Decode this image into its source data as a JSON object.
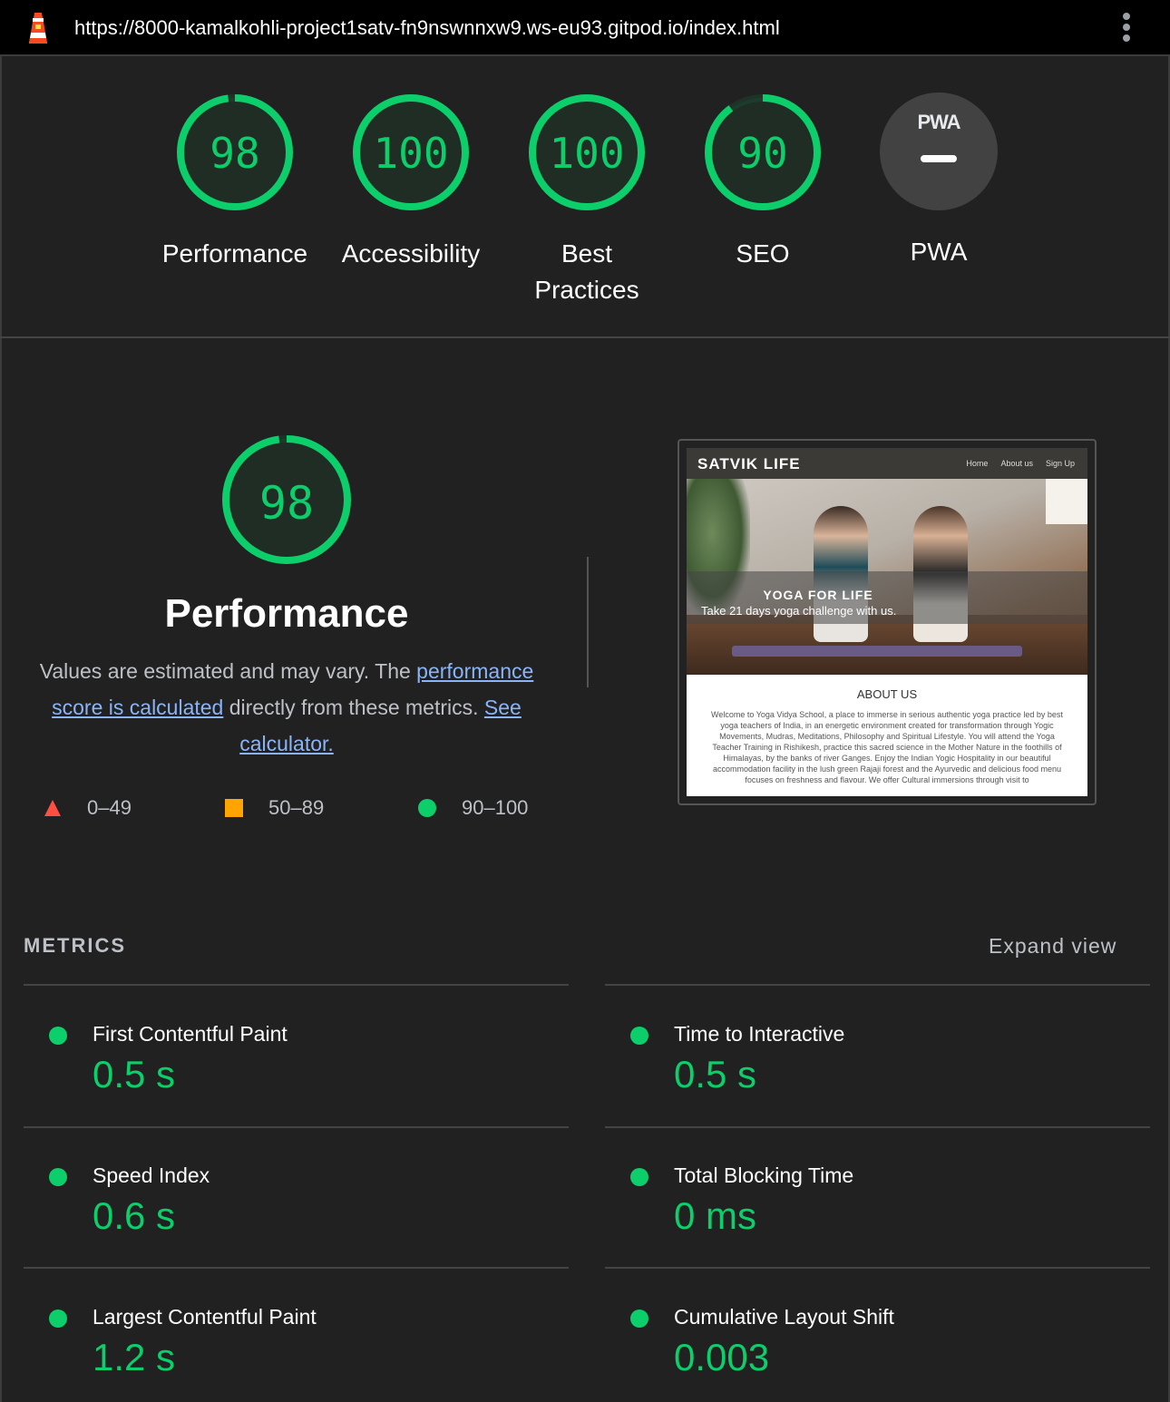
{
  "browser": {
    "url": "https://8000-kamalkohli-project1satv-fn9nswnnxw9.ws-eu93.gitpod.io/index.html"
  },
  "summary": {
    "categories": [
      {
        "label": "Performance",
        "score": "98",
        "value": 98
      },
      {
        "label": "Accessibility",
        "score": "100",
        "value": 100
      },
      {
        "label": "Best Practices",
        "score": "100",
        "value": 100
      },
      {
        "label": "SEO",
        "score": "90",
        "value": 90
      }
    ],
    "pwa": {
      "label": "PWA",
      "badge": "PWA"
    }
  },
  "performance": {
    "score": "98",
    "value": 98,
    "title": "Performance",
    "desc_prefix": "Values are estimated and may vary. The ",
    "link1": "performance score is calculated",
    "desc_middle": " directly from these metrics. ",
    "link2": "See calculator.",
    "legend": [
      {
        "range": "0–49",
        "color": "#ff4e42"
      },
      {
        "range": "50–89",
        "color": "#ffa400"
      },
      {
        "range": "90–100",
        "color": "#0cce6b"
      }
    ]
  },
  "thumbnail": {
    "brand": "SATVIK LIFE",
    "nav": [
      "Home",
      "About us",
      "Sign Up"
    ],
    "hero_title": "YOGA FOR LIFE",
    "hero_subtitle": "Take 21 days yoga challenge with us.",
    "about_title": "ABOUT US",
    "about_text": "Welcome to Yoga Vidya School, a place to immerse in serious authentic yoga practice led by best yoga teachers of India, in an energetic environment created for transformation through Yogic Movements, Mudras, Meditations, Philosophy and Spiritual Lifestyle. You will attend the Yoga Teacher Training in Rishikesh, practice this sacred science in the Mother Nature in the foothills of Himalayas, by the banks of river Ganges. Enjoy the Indian Yogic Hospitality in our beautiful accommodation facility in the lush green Rajaji forest and the Ayurvedic and delicious food menu focuses on freshness and flavour. We offer Cultural immersions through visit to"
  },
  "metrics": {
    "title": "METRICS",
    "expand": "Expand view",
    "items": [
      {
        "label": "First Contentful Paint",
        "value": "0.5 s"
      },
      {
        "label": "Time to Interactive",
        "value": "0.5 s"
      },
      {
        "label": "Speed Index",
        "value": "0.6 s"
      },
      {
        "label": "Total Blocking Time",
        "value": "0 ms"
      },
      {
        "label": "Largest Contentful Paint",
        "value": "1.2 s"
      },
      {
        "label": "Cumulative Layout Shift",
        "value": "0.003"
      }
    ]
  },
  "colors": {
    "pass": "#0cce6b",
    "average": "#ffa400",
    "fail": "#ff4e42",
    "link": "#8ab4f8"
  }
}
